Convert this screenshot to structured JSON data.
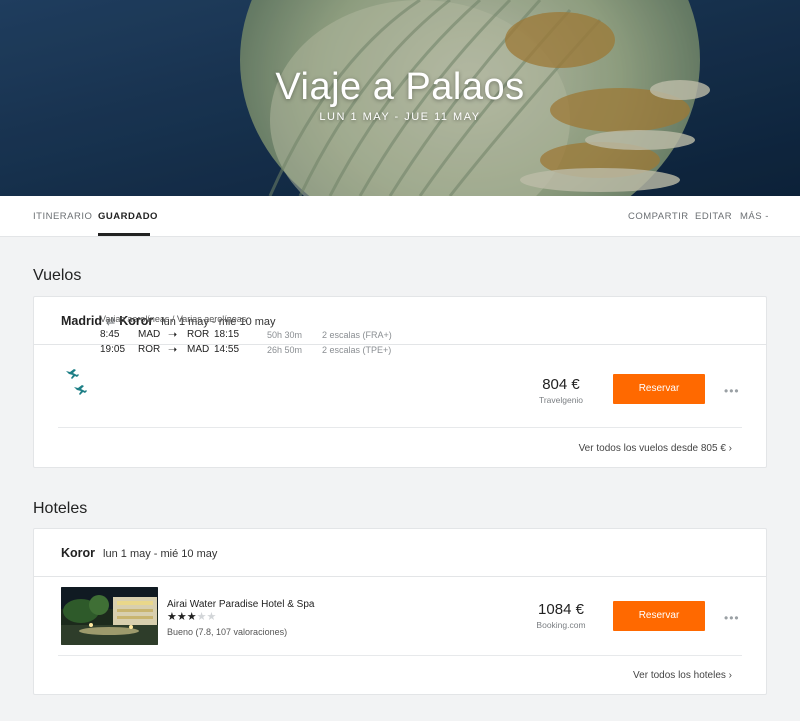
{
  "trip": {
    "title": "Viaje a Palaos",
    "dates": "LUN 1 MAY - JUE 11 MAY"
  },
  "tabs": {
    "itinerary": "ITINERARIO",
    "saved": "GUARDADO",
    "share": "COMPARTIR",
    "edit": "EDITAR",
    "more": "MÁS -"
  },
  "flights": {
    "section_title": "Vuelos",
    "origin": "Madrid",
    "destination": "Koror",
    "arrows": "⇄",
    "dates": "lun 1 may - mié 10 may",
    "airlines": "Varias aerolíneas / Varias aerolíneas",
    "legs": [
      {
        "depart": "8:45",
        "from": "MAD",
        "to": "ROR",
        "arrive": "18:15",
        "duration": "50h 30m",
        "stops": "2 escalas (FRA+)"
      },
      {
        "depart": "19:05",
        "from": "ROR",
        "to": "MAD",
        "arrive": "14:55",
        "duration": "26h 50m",
        "stops": "2 escalas (TPE+)"
      }
    ],
    "price": "804 €",
    "provider": "Travelgenio",
    "book_label": "Reservar",
    "more_icon": "more-horizontal-icon",
    "see_all": "Ver todos los vuelos desde 805 € ›"
  },
  "hotels": {
    "section_title": "Hoteles",
    "city": "Koror",
    "dates": "lun 1 may - mié 10 may",
    "hotel_name": "Airai Water Paradise Hotel & Spa",
    "stars": 3,
    "stars_max": 5,
    "rating_text": "Bueno (7.8, 107 valoraciones)",
    "price": "1084 €",
    "provider": "Booking.com",
    "book_label": "Reservar",
    "see_all": "Ver todos los hoteles ›"
  },
  "colors": {
    "accent": "#ff6900",
    "plane_icon": "#1e7f86",
    "hero_bg": "#143052"
  }
}
